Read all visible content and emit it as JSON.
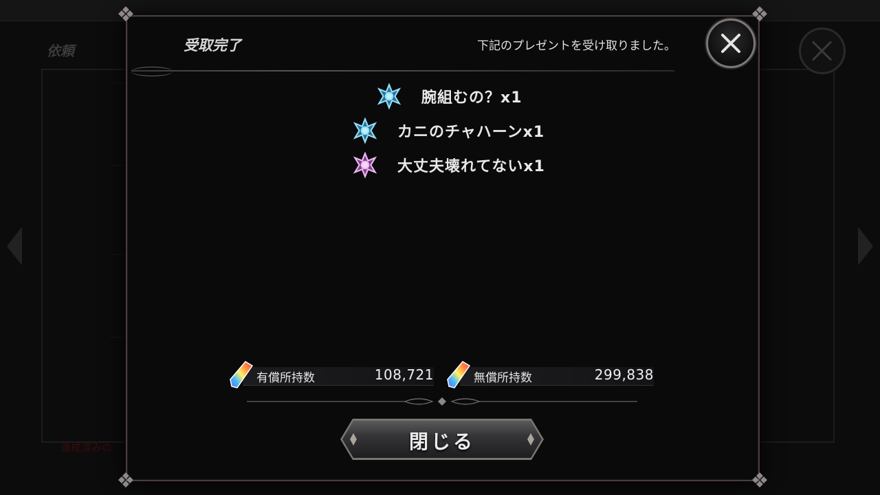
{
  "background": {
    "screen_title": "依頼",
    "note_text": "達成済みの"
  },
  "dialog": {
    "title": "受取完了",
    "message": "下記のプレゼントを受け取りました。",
    "rewards": [
      {
        "label": "腕組むの？x1",
        "icon": "blue-crest-icon",
        "color": "#7fd3f0"
      },
      {
        "label": "カニのチャハーンx1",
        "icon": "blue-crest-icon",
        "color": "#7fd3f0"
      },
      {
        "label": "大丈夫壊れてないx1",
        "icon": "pink-crest-icon",
        "color": "#e3a6e8"
      }
    ],
    "paid_gems": {
      "label": "有償所持数",
      "value": "108,721"
    },
    "free_gems": {
      "label": "無償所持数",
      "value": "299,838"
    },
    "close_button_label": "閉じる"
  }
}
